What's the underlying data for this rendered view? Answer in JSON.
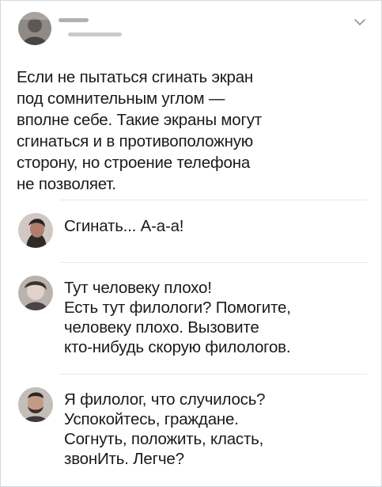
{
  "header": {
    "avatar_icon": "user-avatar-icon",
    "name_blurred": "",
    "menu_icon": "chevron-down-icon"
  },
  "tweet": {
    "text": "Если не пытаться сгинать экран\nпод сомнительным углом —\nвполне себе. Такие экраны могут\nсгинаться и в противоположную\nсторону, но строение телефона\nне позволяет."
  },
  "replies": [
    {
      "avatar_icon": "user-avatar-icon",
      "text": "Сгинать... А-а-а!"
    },
    {
      "avatar_icon": "user-avatar-icon",
      "text": "Тут человеку плохо!\nЕсть тут филологи? Помогите,\nчеловеку плохо. Вызовите\nкто-нибудь скорую филологов."
    },
    {
      "avatar_icon": "user-avatar-icon",
      "text": "Я филолог, что случилось?\nУспокойтесь, граждане.\nСогнуть, положить, класть,\nзвонИть. Легче?"
    }
  ],
  "colors": {
    "text": "#1a1a1a",
    "divider": "#e1e8ed",
    "border": "#cfd9de"
  }
}
